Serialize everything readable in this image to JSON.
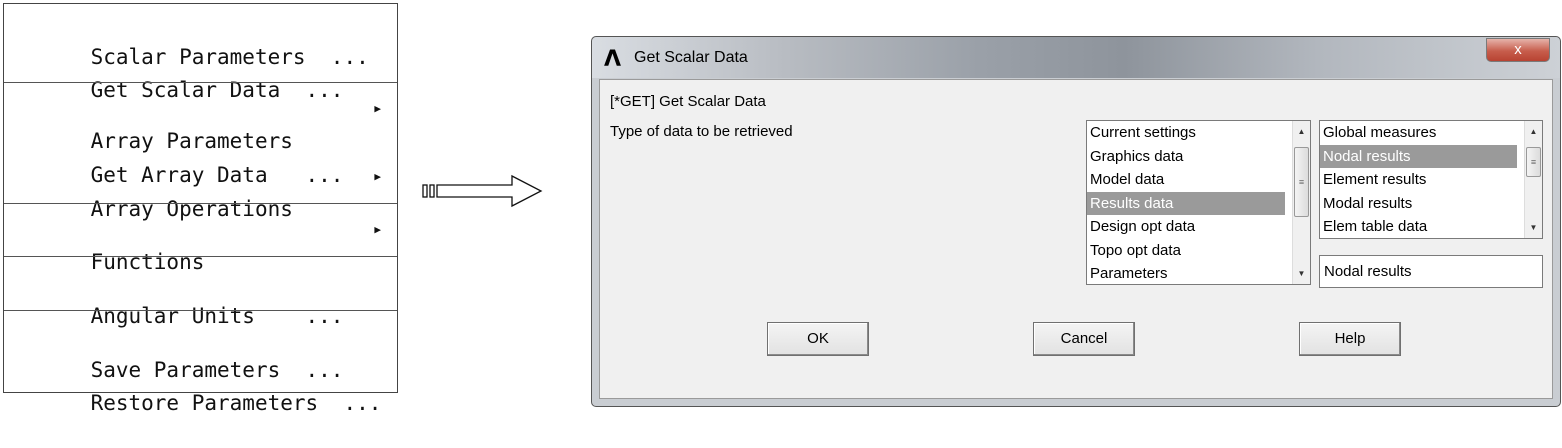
{
  "menu": {
    "items": [
      {
        "label": "Scalar Parameters  ...",
        "submenu": false
      },
      {
        "label": "Get Scalar Data  ...",
        "submenu": false
      },
      {
        "label": "Array Parameters",
        "submenu": true
      },
      {
        "label": "Get Array Data   ...",
        "submenu": false
      },
      {
        "label": "Array Operations",
        "submenu": true
      },
      {
        "label": "Functions",
        "submenu": true
      },
      {
        "label": "Angular Units    ...",
        "submenu": false
      },
      {
        "label": "Save Parameters  ...",
        "submenu": false
      },
      {
        "label": "Restore Parameters  ...",
        "submenu": false
      }
    ],
    "submenu_glyph": "▶"
  },
  "dialog": {
    "logo": "Λ",
    "title": "Get Scalar Data",
    "close_glyph": "x",
    "command_label": "[*GET]  Get Scalar Data",
    "prompt_label": "Type of data to be retrieved",
    "left_list": {
      "items": [
        "Current settings",
        "Graphics data",
        "Model data",
        "Results data",
        "Design opt data",
        "Topo opt data",
        "Parameters"
      ],
      "selected": "Results data"
    },
    "right_list": {
      "items": [
        "Global measures",
        "Nodal results",
        "Element results",
        "Modal results",
        "Elem table data"
      ],
      "selected": "Nodal results"
    },
    "selection_field": "Nodal results",
    "buttons": {
      "ok": "OK",
      "cancel": "Cancel",
      "help": "Help"
    },
    "scroll_up_glyph": "▲",
    "scroll_down_glyph": "▼",
    "grip_glyph": "≡"
  },
  "colors": {
    "selection_bg": "#9a9a9a",
    "close_button": "#c75d4c",
    "dialog_face": "#f0f0f0"
  }
}
